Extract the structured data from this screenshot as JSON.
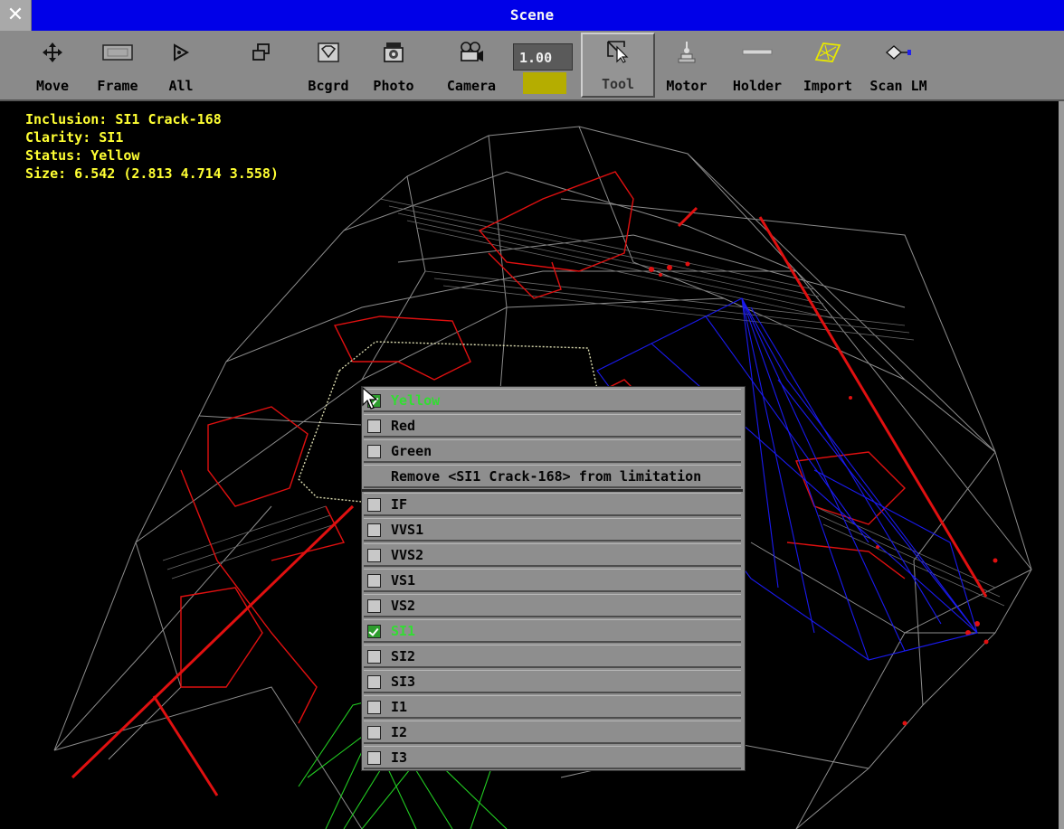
{
  "window": {
    "title": "Scene",
    "close_symbol": "✕"
  },
  "toolbar": {
    "move": "Move",
    "frame": "Frame",
    "all": "All",
    "bcgrd": "Bcgrd",
    "photo": "Photo",
    "camera": "Camera",
    "zoom": "1.00",
    "tool": "Tool",
    "motor": "Motor",
    "holder": "Holder",
    "import": "Import",
    "scan_lm": "Scan LM",
    "color_swatch": "#b5ad00"
  },
  "info": {
    "inclusion": "Inclusion: SI1 Crack-168",
    "clarity": "Clarity: SI1",
    "status": "Status: Yellow",
    "size": "Size: 6.542 (2.813 4.714 3.558)"
  },
  "menu": {
    "status_items": [
      {
        "label": "Yellow",
        "checked": true
      },
      {
        "label": "Red",
        "checked": false
      },
      {
        "label": "Green",
        "checked": false
      }
    ],
    "remove_label": "Remove <SI1 Crack-168> from limitation",
    "clarity_items": [
      {
        "label": "IF",
        "checked": false
      },
      {
        "label": "VVS1",
        "checked": false
      },
      {
        "label": "VVS2",
        "checked": false
      },
      {
        "label": "VS1",
        "checked": false
      },
      {
        "label": "VS2",
        "checked": false
      },
      {
        "label": "SI1",
        "checked": true
      },
      {
        "label": "SI2",
        "checked": false
      },
      {
        "label": "SI3",
        "checked": false
      },
      {
        "label": "I1",
        "checked": false
      },
      {
        "label": "I2",
        "checked": false
      },
      {
        "label": "I3",
        "checked": false
      }
    ]
  },
  "colors": {
    "title_bar": "#0000e8",
    "info_text": "#ffff33",
    "checked": "#33dd33",
    "mesh": "#9a9a9a",
    "red_inclusions": "#e01010",
    "blue_inclusions": "#1a1aee",
    "green_inclusions": "#22cc22"
  }
}
